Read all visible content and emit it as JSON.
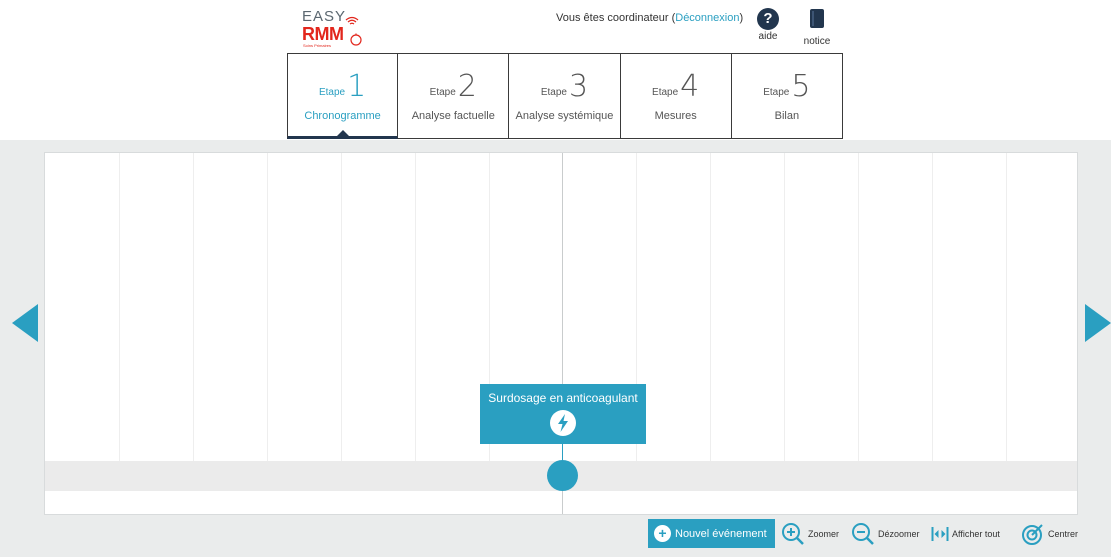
{
  "header": {
    "logo": {
      "line1": "EASY",
      "line2": "RMM",
      "tagline": "Soins Primaires"
    },
    "user_status_prefix": "Vous êtes coordinateur (",
    "logout_link": "Déconnexion",
    "user_status_suffix": ")",
    "help_label": "aide",
    "notice_label": "notice"
  },
  "steps": [
    {
      "word": "Etape",
      "number": "1",
      "name": "Chronogramme",
      "active": true
    },
    {
      "word": "Etape",
      "number": "2",
      "name": "Analyse factuelle",
      "active": false
    },
    {
      "word": "Etape",
      "number": "3",
      "name": "Analyse systémique",
      "active": false
    },
    {
      "word": "Etape",
      "number": "4",
      "name": "Mesures",
      "active": false
    },
    {
      "word": "Etape",
      "number": "5",
      "name": "Bilan",
      "active": false
    }
  ],
  "timeline": {
    "events": [
      {
        "title": "Surdosage en anticoagulant",
        "icon": "lightning-icon"
      }
    ]
  },
  "toolbar": {
    "new_event_label": "Nouvel événement",
    "zoom_in_label": "Zoomer",
    "zoom_out_label": "Dézoomer",
    "show_all_label": "Afficher tout",
    "center_label": "Centrer"
  },
  "colors": {
    "accent": "#2a9fc1",
    "navy": "#22364e",
    "logo_red": "#e2261c",
    "band_gray": "#eaecec"
  }
}
